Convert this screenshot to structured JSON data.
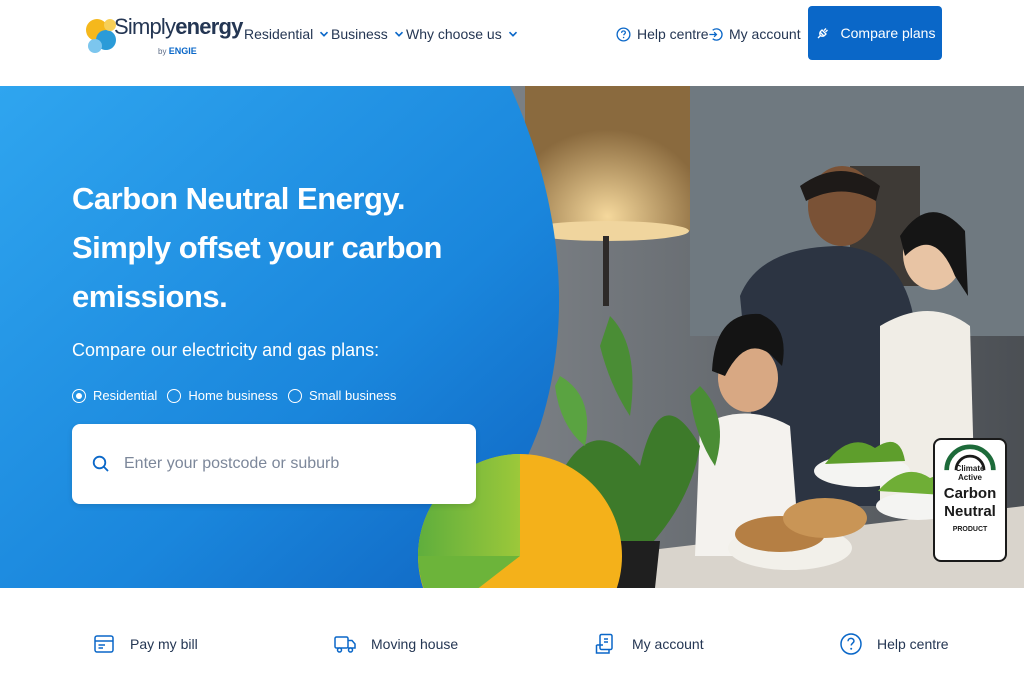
{
  "brand": {
    "name_light": "Simply",
    "name_bold": "energy",
    "by": "by",
    "parent": "ENGIE"
  },
  "nav": {
    "items": [
      {
        "label": "Residential"
      },
      {
        "label": "Business"
      },
      {
        "label": "Why choose us"
      }
    ],
    "help_label": "Help centre",
    "account_label": "My account",
    "compare_label": "Compare plans"
  },
  "hero": {
    "title": "Carbon Neutral Energy. Simply offset your carbon emissions.",
    "subtitle": "Compare our electricity and gas plans:",
    "options": [
      {
        "label": "Residential",
        "selected": true
      },
      {
        "label": "Home business",
        "selected": false
      },
      {
        "label": "Small business",
        "selected": false
      }
    ],
    "search_placeholder": "Enter your postcode or suburb"
  },
  "badge": {
    "line1": "Climate",
    "line2": "Active",
    "line3": "Carbon",
    "line4": "Neutral",
    "line5": "PRODUCT"
  },
  "quick_links": [
    {
      "label": "Pay my bill",
      "icon": "bill-icon"
    },
    {
      "label": "Moving house",
      "icon": "truck-icon"
    },
    {
      "label": "My account",
      "icon": "account-device-icon"
    },
    {
      "label": "Help centre",
      "icon": "question-icon"
    }
  ],
  "colors": {
    "primary": "#0a67c8",
    "text": "#243653",
    "hero_blue": "#1a8ee6"
  }
}
